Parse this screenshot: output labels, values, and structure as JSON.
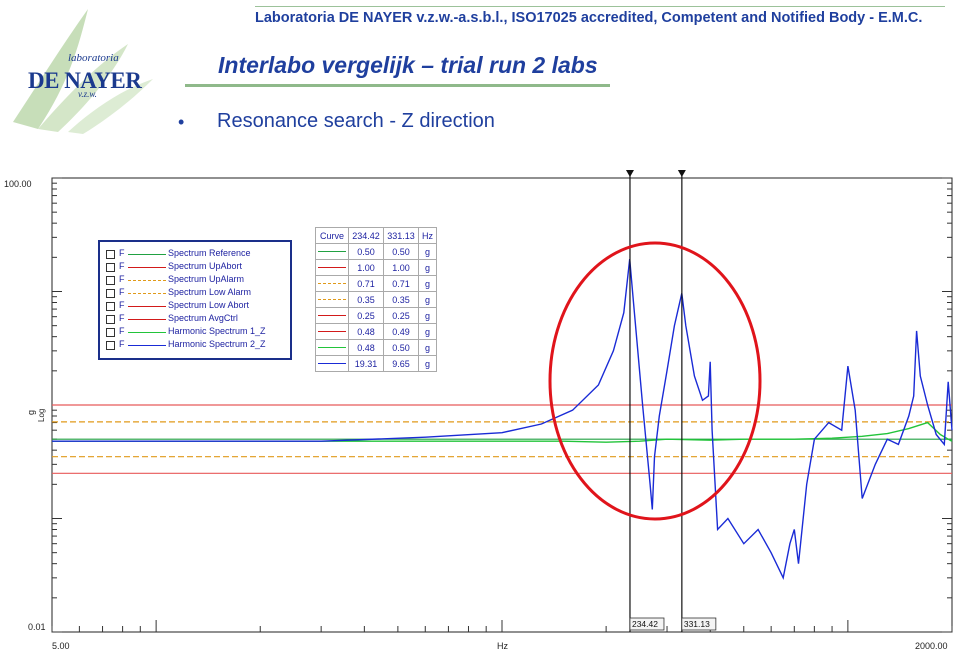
{
  "header": {
    "top_line": "Laboratoria DE NAYER v.z.w.-a.s.b.l., ISO17025 accredited, Competent and Notified Body - E.M.C.",
    "title": "Interlabo vergelijk – trial run 2 labs",
    "bullet": "•",
    "subtitle": "Resonance search  - Z direction"
  },
  "logo": {
    "script": "laboratoria",
    "name": "DE NAYER",
    "sub": "v.z.w."
  },
  "colors": {
    "accent": "#1f3f9e",
    "rule": "#8fb98a",
    "circle": "#e0141b"
  },
  "chart_data": {
    "type": "line",
    "x_scale": "log",
    "y_scale": "log",
    "xlim": [
      5.0,
      2000.0
    ],
    "ylim": [
      0.01,
      100.0
    ],
    "x_tick_labels": [
      "5.00",
      "2000.00"
    ],
    "y_tick_labels": [
      "100.00",
      "0.01"
    ],
    "xlabel": "Hz",
    "ylabel": "g",
    "ylabel_scale": "Log",
    "cursors": [
      {
        "x": 234.42,
        "label": "234.42"
      },
      {
        "x": 331.13,
        "label": "331.13"
      }
    ],
    "legend": [
      {
        "flag": "F",
        "name": "Spectrum Reference",
        "color": "#21a142",
        "dash": "solid"
      },
      {
        "flag": "F",
        "name": "Spectrum UpAbort",
        "color": "#d21a1a",
        "dash": "solid"
      },
      {
        "flag": "F",
        "name": "Spectrum UpAlarm",
        "color": "#e09a1a",
        "dash": "dashed"
      },
      {
        "flag": "F",
        "name": "Spectrum Low Alarm",
        "color": "#e09a1a",
        "dash": "dashed"
      },
      {
        "flag": "F",
        "name": "Spectrum Low Abort",
        "color": "#d21a1a",
        "dash": "solid"
      },
      {
        "flag": "F",
        "name": "Spectrum AvgCtrl",
        "color": "#d21a1a",
        "dash": "solid"
      },
      {
        "flag": "F",
        "name": "Harmonic Spectrum 1_Z",
        "color": "#22c43a",
        "dash": "solid"
      },
      {
        "flag": "F",
        "name": "Harmonic Spectrum 2_Z",
        "color": "#1a2bd6",
        "dash": "solid"
      }
    ],
    "cursor_table": {
      "headers": [
        "Curve",
        "234.42",
        "331.13",
        "Hz"
      ],
      "rows": [
        {
          "color": "#21a142",
          "dash": "solid",
          "v1": "0.50",
          "v2": "0.50",
          "unit": "g"
        },
        {
          "color": "#d21a1a",
          "dash": "solid",
          "v1": "1.00",
          "v2": "1.00",
          "unit": "g"
        },
        {
          "color": "#e09a1a",
          "dash": "dashed",
          "v1": "0.71",
          "v2": "0.71",
          "unit": "g"
        },
        {
          "color": "#e09a1a",
          "dash": "dashed",
          "v1": "0.35",
          "v2": "0.35",
          "unit": "g"
        },
        {
          "color": "#d21a1a",
          "dash": "solid",
          "v1": "0.25",
          "v2": "0.25",
          "unit": "g"
        },
        {
          "color": "#d21a1a",
          "dash": "solid",
          "v1": "0.48",
          "v2": "0.49",
          "unit": "g"
        },
        {
          "color": "#22c43a",
          "dash": "solid",
          "v1": "0.48",
          "v2": "0.50",
          "unit": "g"
        },
        {
          "color": "#1a2bd6",
          "dash": "solid",
          "v1": "19.31",
          "v2": "9.65",
          "unit": "g"
        }
      ]
    },
    "series": [
      {
        "name": "Spectrum Reference",
        "color": "#21a142",
        "dash": "solid",
        "x": [
          5,
          2000
        ],
        "y": [
          0.5,
          0.5
        ]
      },
      {
        "name": "Spectrum UpAbort",
        "color": "#e85a5a",
        "dash": "solid",
        "x": [
          5,
          2000
        ],
        "y": [
          1.0,
          1.0
        ]
      },
      {
        "name": "Spectrum UpAlarm",
        "color": "#e09a1a",
        "dash": "dashed",
        "x": [
          5,
          2000
        ],
        "y": [
          0.71,
          0.71
        ]
      },
      {
        "name": "Spectrum Low Alarm",
        "color": "#e09a1a",
        "dash": "dashed",
        "x": [
          5,
          2000
        ],
        "y": [
          0.35,
          0.35
        ]
      },
      {
        "name": "Spectrum Low Abort",
        "color": "#e85a5a",
        "dash": "solid",
        "x": [
          5,
          2000
        ],
        "y": [
          0.25,
          0.25
        ]
      },
      {
        "name": "Harmonic Spectrum 1_Z",
        "color": "#22c43a",
        "dash": "solid",
        "x": [
          5,
          100,
          150,
          200,
          250,
          300,
          400,
          500,
          700,
          900,
          1100,
          1300,
          1500,
          1700,
          1850,
          1950,
          2000
        ],
        "y": [
          0.48,
          0.48,
          0.48,
          0.47,
          0.48,
          0.5,
          0.49,
          0.5,
          0.5,
          0.51,
          0.53,
          0.56,
          0.62,
          0.7,
          0.55,
          0.5,
          0.48
        ]
      },
      {
        "name": "Harmonic Spectrum 2_Z",
        "color": "#1a2bd6",
        "dash": "solid",
        "x": [
          5,
          30,
          60,
          100,
          130,
          160,
          190,
          210,
          225,
          234,
          240,
          255,
          268,
          272,
          276,
          285,
          300,
          315,
          331,
          340,
          360,
          380,
          395,
          400,
          405,
          420,
          450,
          500,
          550,
          600,
          650,
          680,
          700,
          720,
          760,
          800,
          880,
          960,
          1000,
          1050,
          1100,
          1200,
          1300,
          1400,
          1500,
          1550,
          1580,
          1620,
          1700,
          1800,
          1900,
          1950,
          2000
        ],
        "y": [
          0.48,
          0.48,
          0.52,
          0.57,
          0.68,
          0.9,
          1.5,
          3.0,
          6.5,
          19.31,
          8.0,
          1.0,
          0.2,
          0.12,
          0.35,
          0.8,
          2.0,
          5.0,
          9.65,
          5.0,
          1.8,
          1.1,
          1.2,
          2.4,
          0.6,
          0.08,
          0.1,
          0.06,
          0.08,
          0.05,
          0.03,
          0.06,
          0.08,
          0.04,
          0.2,
          0.5,
          0.7,
          0.6,
          2.2,
          0.9,
          0.15,
          0.3,
          0.5,
          0.45,
          0.8,
          1.2,
          4.5,
          1.8,
          1.0,
          0.55,
          0.45,
          1.6,
          0.6
        ]
      }
    ]
  }
}
